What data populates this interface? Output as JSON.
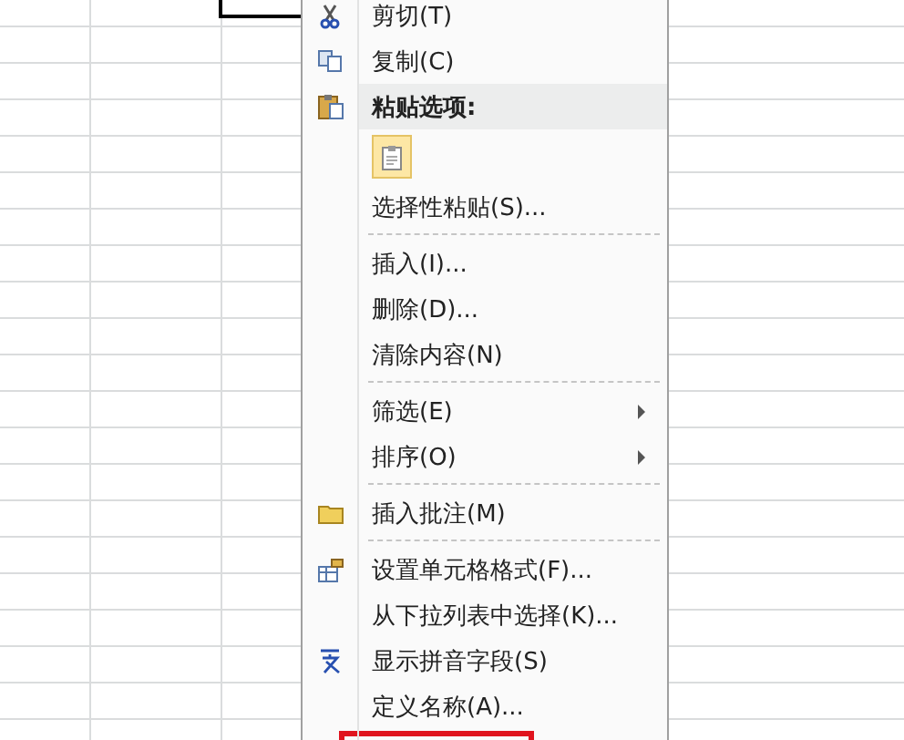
{
  "context_menu": {
    "items": [
      {
        "kind": "command",
        "label": "剪切(T)",
        "submenu": false
      },
      {
        "kind": "command",
        "label": "复制(C)",
        "submenu": false
      },
      {
        "kind": "header",
        "label": "粘贴选项:"
      },
      {
        "kind": "paste_option"
      },
      {
        "kind": "command",
        "label": "选择性粘贴(S)...",
        "submenu": false
      },
      {
        "kind": "separator"
      },
      {
        "kind": "command",
        "label": "插入(I)...",
        "submenu": false
      },
      {
        "kind": "command",
        "label": "删除(D)...",
        "submenu": false
      },
      {
        "kind": "command",
        "label": "清除内容(N)",
        "submenu": false
      },
      {
        "kind": "separator"
      },
      {
        "kind": "command",
        "label": "筛选(E)",
        "submenu": true
      },
      {
        "kind": "command",
        "label": "排序(O)",
        "submenu": true
      },
      {
        "kind": "separator"
      },
      {
        "kind": "command",
        "label": "插入批注(M)",
        "submenu": false
      },
      {
        "kind": "separator"
      },
      {
        "kind": "command",
        "label": "设置单元格格式(F)...",
        "submenu": false
      },
      {
        "kind": "command",
        "label": "从下拉列表中选择(K)...",
        "submenu": false
      },
      {
        "kind": "command",
        "label": "显示拼音字段(S)",
        "submenu": false
      },
      {
        "kind": "command",
        "label": "定义名称(A)...",
        "submenu": false
      },
      {
        "kind": "highlighted_cut"
      }
    ]
  }
}
